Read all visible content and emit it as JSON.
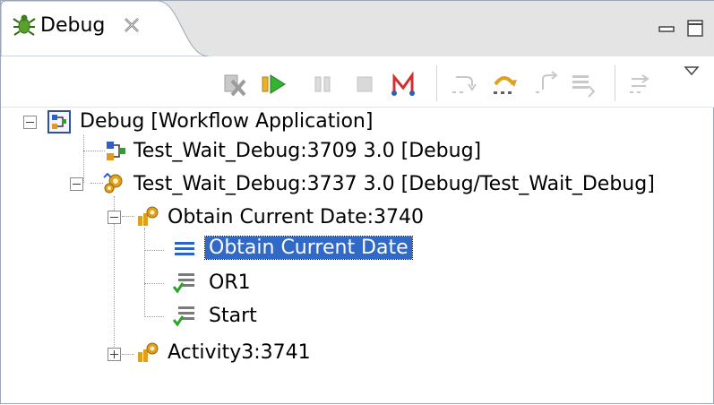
{
  "tab": {
    "title": "Debug",
    "icon": "bug-icon",
    "close_icon": "close-icon"
  },
  "window_controls": [
    "minimize-icon",
    "maximize-icon"
  ],
  "toolbar": {
    "buttons": [
      {
        "name": "remove-terminated-button",
        "icon": "remove-all-terminated-icon"
      },
      {
        "name": "resume-button",
        "icon": "resume-icon"
      },
      {
        "name": "suspend-button",
        "icon": "suspend-icon"
      },
      {
        "name": "terminate-button",
        "icon": "terminate-icon"
      },
      {
        "name": "disconnect-button",
        "icon": "disconnect-icon"
      },
      {
        "name": "step-into-button",
        "icon": "step-into-icon"
      },
      {
        "name": "step-over-button",
        "icon": "step-over-icon"
      },
      {
        "name": "step-return-button",
        "icon": "step-return-icon"
      },
      {
        "name": "drop-to-frame-button",
        "icon": "drop-to-frame-icon"
      },
      {
        "name": "use-step-filters-button",
        "icon": "step-filters-icon"
      },
      {
        "name": "view-menu-button",
        "icon": "view-menu-icon"
      }
    ]
  },
  "tree": {
    "root": {
      "label": "Debug [Workflow Application]",
      "expanded": true
    },
    "process_1": {
      "label": "Test_Wait_Debug:3709 3.0 [Debug]"
    },
    "process_2": {
      "label": "Test_Wait_Debug:3737 3.0 [Debug/Test_Wait_Debug]",
      "expanded": true
    },
    "thread_1": {
      "label": "Obtain Current Date:3740",
      "expanded": true
    },
    "frame_1": {
      "label": "Obtain Current Date",
      "selected": true
    },
    "frame_2": {
      "label": "OR1"
    },
    "frame_3": {
      "label": "Start"
    },
    "thread_2": {
      "label": "Activity3:3741",
      "expanded": false
    }
  },
  "colors": {
    "selection": "#3069c6",
    "resume_green": "#28a428",
    "tab_bg": "#e4e4e4"
  }
}
